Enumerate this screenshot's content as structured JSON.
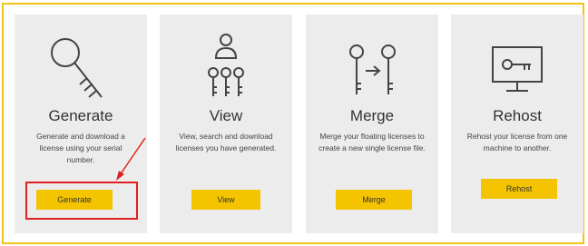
{
  "accent_color": "#f5c400",
  "highlight_color": "#e02020",
  "cards": [
    {
      "icon": "key-icon",
      "title": "Generate",
      "description": "Generate and download a license using your serial number.",
      "button_label": "Generate"
    },
    {
      "icon": "user-keys-icon",
      "title": "View",
      "description": "View, search and download licenses you have generated.",
      "button_label": "View"
    },
    {
      "icon": "merge-keys-icon",
      "title": "Merge",
      "description": "Merge your floating licenses to create a new single license file.",
      "button_label": "Merge"
    },
    {
      "icon": "monitor-key-icon",
      "title": "Rehost",
      "description": "Rehost your license from one machine to another.",
      "button_label": "Rehost"
    }
  ]
}
